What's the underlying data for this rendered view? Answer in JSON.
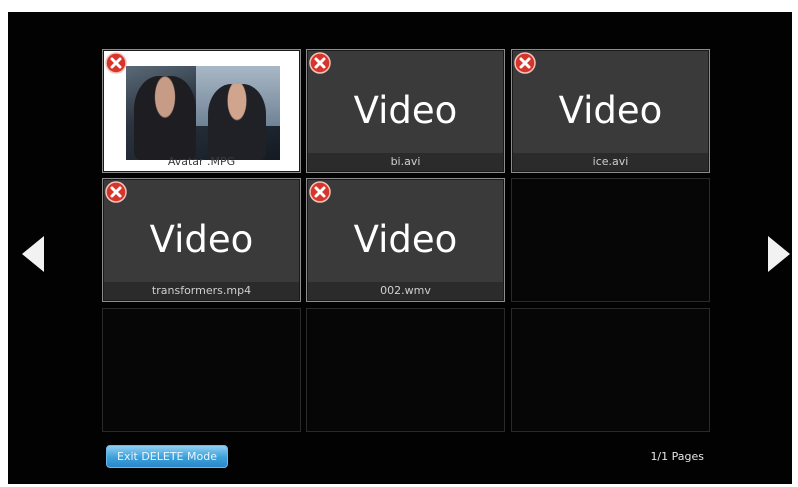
{
  "navigation": {
    "prev_icon": "triangle-left-icon",
    "next_icon": "triangle-right-icon"
  },
  "videos": [
    {
      "name": "Avatar .MPG",
      "thumbnail": "photo"
    },
    {
      "name": "bi.avi",
      "placeholder": "Video"
    },
    {
      "name": "ice.avi",
      "placeholder": "Video"
    },
    {
      "name": "transformers.mp4",
      "placeholder": "Video"
    },
    {
      "name": "002.wmv",
      "placeholder": "Video"
    }
  ],
  "delete_icon": "delete-x-icon",
  "footer": {
    "exit_label": "Exit DELETE Mode",
    "page_indicator": "1/1 Pages"
  },
  "colors": {
    "background": "#020202",
    "tile": "#3a3a3a",
    "delete_red": "#d8352a",
    "button_blue": "#3b9fda"
  }
}
